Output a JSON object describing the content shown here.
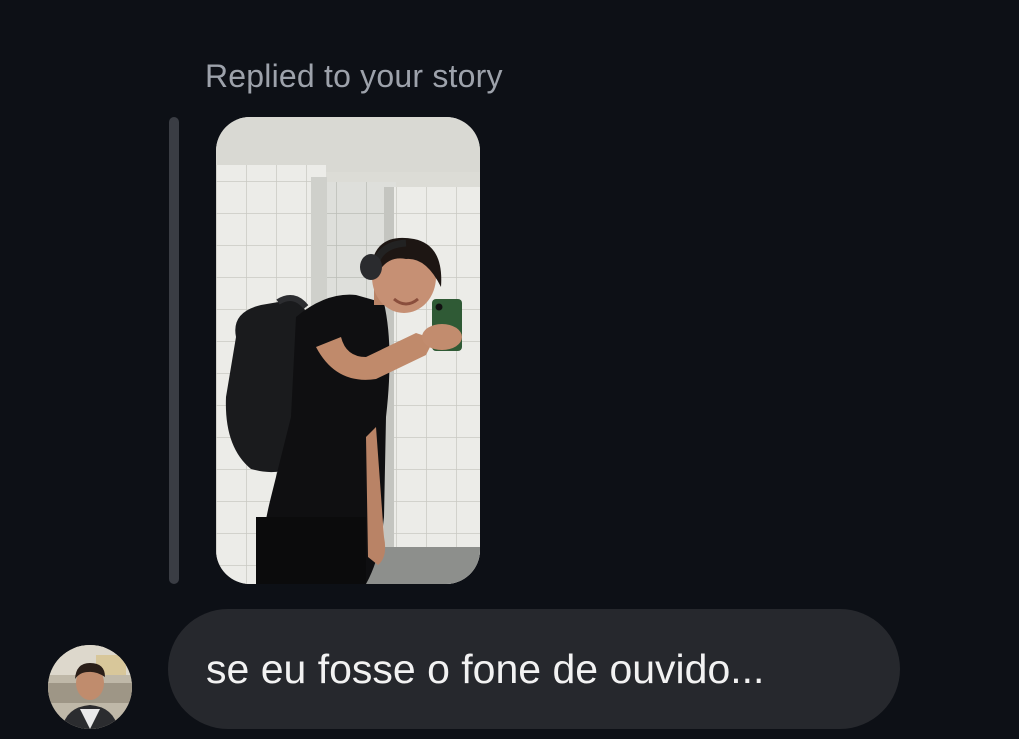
{
  "reply": {
    "caption": "Replied to your story"
  },
  "story": {
    "media": "story-photo-mirror-selfie"
  },
  "message": {
    "text": "se eu fosse o fone de ouvido..."
  },
  "sender": {
    "avatar": "profile-avatar"
  },
  "colors": {
    "background": "#0d1016",
    "bubble": "#26282d",
    "caption": "#9da2ab",
    "reply_bar": "#3a3d44",
    "message_text": "#f2f2f2"
  }
}
